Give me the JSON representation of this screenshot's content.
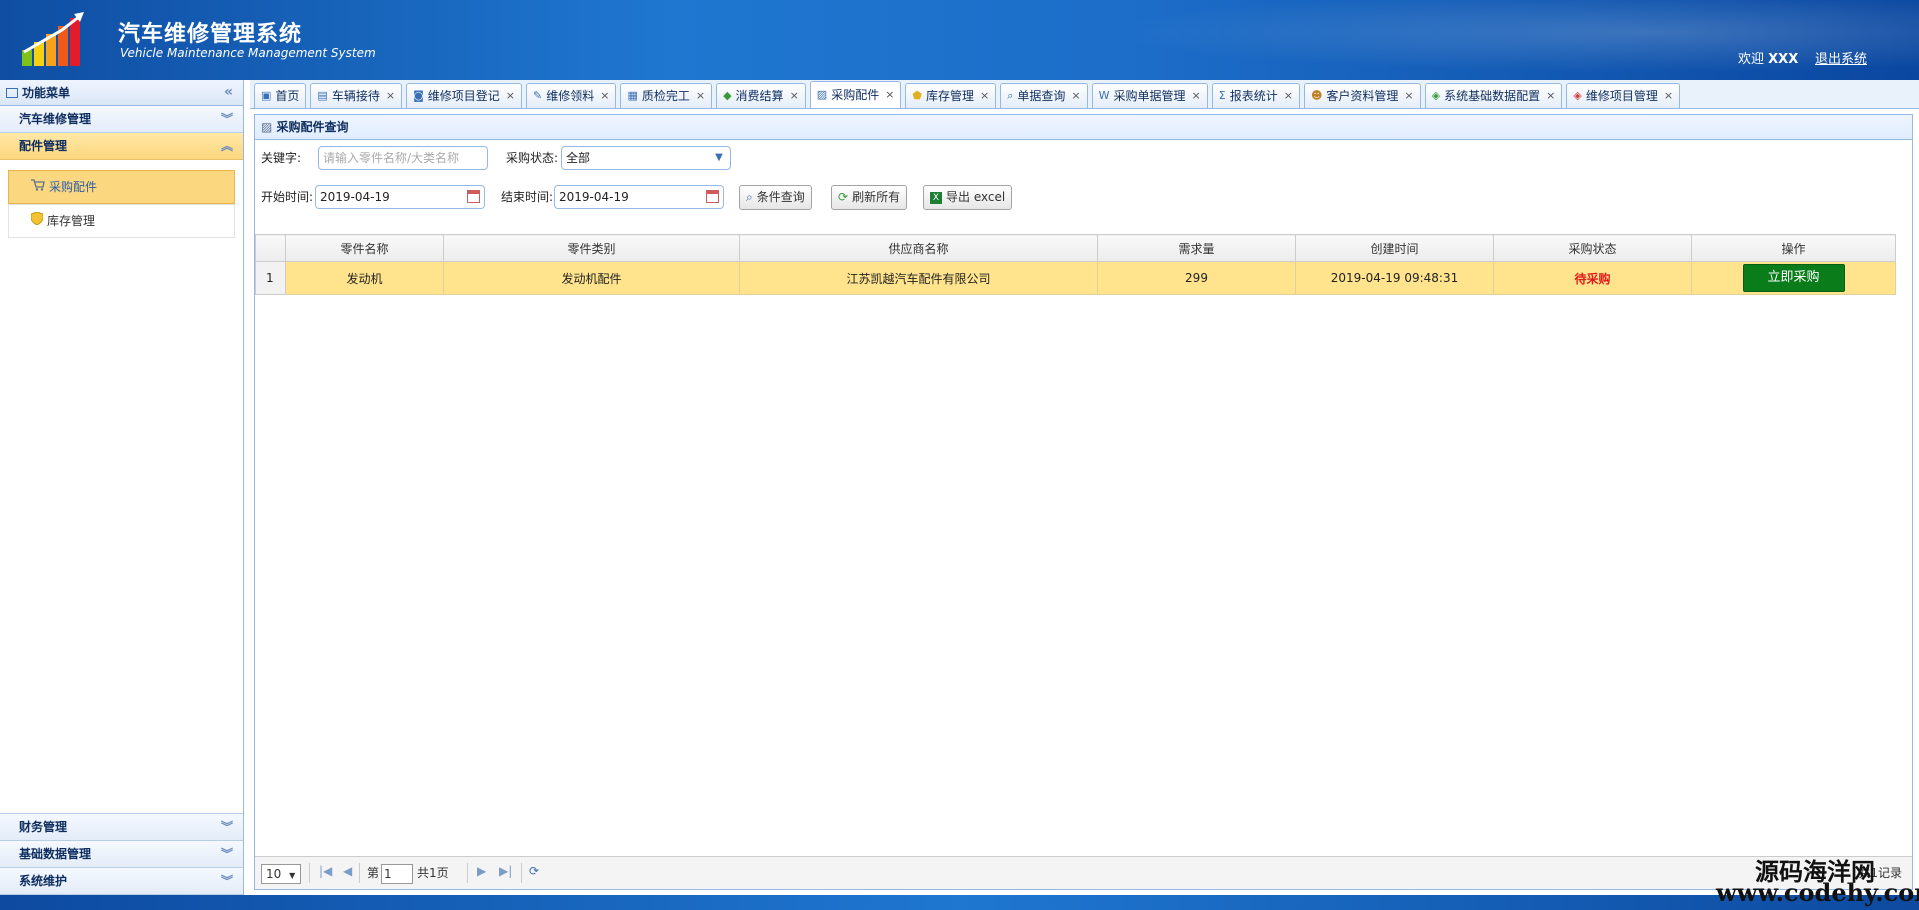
{
  "header": {
    "title_cn": "汽车维修管理系统",
    "title_en": "Vehicle Maintenance Management System",
    "welcome_prefix": "欢迎",
    "user": "XXX",
    "logout": "退出系统"
  },
  "sidebar": {
    "title": "功能菜单",
    "collapse_glyph": "«",
    "groups_top": [
      {
        "label": "汽车维修管理",
        "glyph": "︾"
      },
      {
        "label": "配件管理",
        "glyph": "︽"
      }
    ],
    "sub_items": [
      {
        "label": "采购配件"
      },
      {
        "label": "库存管理"
      }
    ],
    "groups_bottom": [
      {
        "label": "财务管理",
        "glyph": "︾"
      },
      {
        "label": "基础数据管理",
        "glyph": "︾"
      },
      {
        "label": "系统维护",
        "glyph": "︾"
      }
    ]
  },
  "tabs": [
    {
      "label": "首页",
      "close": ""
    },
    {
      "label": "车辆接待",
      "close": "×"
    },
    {
      "label": "维修项目登记",
      "close": "×"
    },
    {
      "label": "维修领料",
      "close": "×"
    },
    {
      "label": "质检完工",
      "close": "×"
    },
    {
      "label": "消费结算",
      "close": "×"
    },
    {
      "label": "采购配件",
      "close": "×"
    },
    {
      "label": "库存管理",
      "close": "×"
    },
    {
      "label": "单据查询",
      "close": "×"
    },
    {
      "label": "采购单据管理",
      "close": "×"
    },
    {
      "label": "报表统计",
      "close": "×"
    },
    {
      "label": "客户资料管理",
      "close": "×"
    },
    {
      "label": "系统基础数据配置",
      "close": "×"
    },
    {
      "label": "维修项目管理",
      "close": "×"
    }
  ],
  "panel": {
    "title": "采购配件查询"
  },
  "filters": {
    "keyword_label": "关键字:",
    "keyword_placeholder": "请输入零件名称/大类名称",
    "status_label": "采购状态:",
    "status_value": "全部",
    "start_label": "开始时间:",
    "start_value": "2019-04-19",
    "end_label": "结束时间:",
    "end_value": "2019-04-19",
    "query_btn": "条件查询",
    "refresh_btn": "刷新所有",
    "export_btn": "导出 excel"
  },
  "table": {
    "columns": [
      "零件名称",
      "零件类别",
      "供应商名称",
      "需求量",
      "创建时间",
      "采购状态",
      "操作"
    ],
    "rows": [
      {
        "no": "1",
        "name": "发动机",
        "category": "发动机配件",
        "supplier": "江苏凯越汽车配件有限公司",
        "qty": "299",
        "created": "2019-04-19 09:48:31",
        "status": "待采购",
        "action": "立即采购"
      }
    ]
  },
  "pager": {
    "page_size": "10",
    "page_prefix": "第",
    "page_value": "1",
    "page_suffix": "共1页",
    "records": "共1记录"
  },
  "watermark": {
    "line1": "源码海洋网",
    "line2": "www.codehy.com"
  },
  "colors": {
    "header": "#1f77d0",
    "selected_row": "#ffe48d",
    "status_pending": "#e01b1b",
    "buy_button": "#0a7d1a"
  }
}
